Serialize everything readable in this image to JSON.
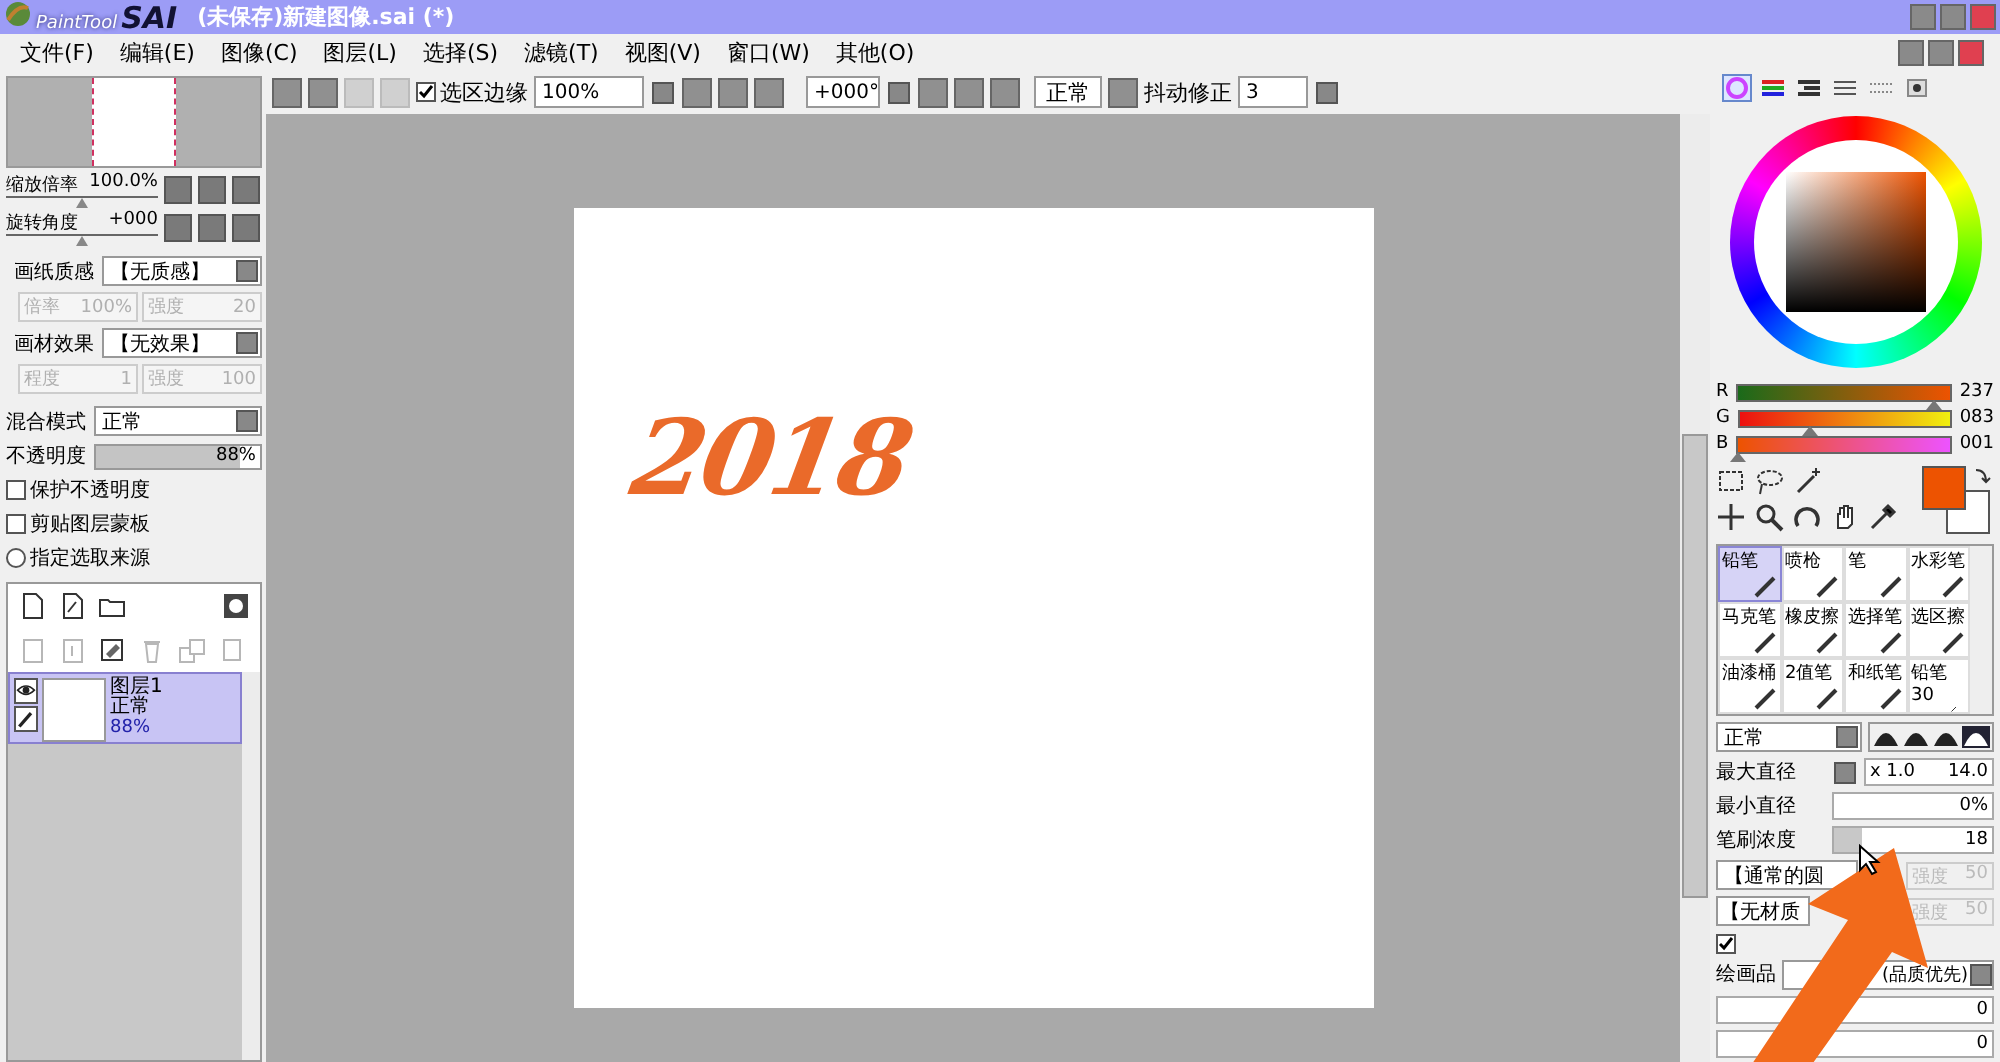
{
  "title_bar": {
    "logo_small": "PaintTool",
    "logo_big": "SAI",
    "document": "(未保存)新建图像.sai (*)"
  },
  "menu": [
    "文件(F)",
    "编辑(E)",
    "图像(C)",
    "图层(L)",
    "选择(S)",
    "滤镜(T)",
    "视图(V)",
    "窗口(W)",
    "其他(O)"
  ],
  "toolbar": {
    "selection_edge": {
      "label": "选区边缘",
      "checked": true
    },
    "zoom": "100%",
    "rotation": "+000°",
    "blend": "正常",
    "stabilizer_label": "抖动修正",
    "stabilizer_value": "3"
  },
  "navigator": {
    "sliders": [
      {
        "label": "缩放倍率",
        "value": "100.0%",
        "level": 0.5
      },
      {
        "label": "旋转角度",
        "value": "+000",
        "level": 0.5
      }
    ]
  },
  "paper": [
    {
      "label": "画纸质感",
      "value": "【无质感】",
      "fields": [
        {
          "label": "倍率",
          "value": "100%",
          "disabled": true
        },
        {
          "label": "强度",
          "value": "20",
          "disabled": true
        }
      ]
    },
    {
      "label": "画材效果",
      "value": "【无效果】",
      "fields": [
        {
          "label": "程度",
          "value": "1",
          "disabled": true
        },
        {
          "label": "强度",
          "value": "100",
          "disabled": true
        }
      ]
    }
  ],
  "layer_props": {
    "blend_label": "混合模式",
    "blend_value": "正常",
    "opacity": {
      "label": "不透明度",
      "value": "88%",
      "level": 0.88
    }
  },
  "options": [
    {
      "kind": "checkbox",
      "label": "保护不透明度",
      "checked": false
    },
    {
      "kind": "checkbox",
      "label": "剪贴图层蒙板",
      "checked": false
    },
    {
      "kind": "radio",
      "label": "指定选取来源",
      "checked": false
    }
  ],
  "layers": [
    {
      "name": "图层1",
      "mode": "正常",
      "opacity": "88%",
      "selected": true
    }
  ],
  "canvas": {
    "artwork": "2018"
  },
  "color": {
    "sliders": [
      {
        "label": "R",
        "value": "237",
        "level": 0.93
      },
      {
        "label": "G",
        "value": "083",
        "level": 0.33
      },
      {
        "label": "B",
        "value": "001",
        "level": 0.0
      }
    ]
  },
  "brushes": [
    {
      "label": "铅笔",
      "selected": true
    },
    {
      "label": "喷枪",
      "selected": false
    },
    {
      "label": "笔",
      "selected": false
    },
    {
      "label": "水彩笔",
      "selected": false
    },
    {
      "label": "马克笔",
      "selected": false
    },
    {
      "label": "橡皮擦",
      "selected": false
    },
    {
      "label": "选择笔",
      "selected": false
    },
    {
      "label": "选区擦",
      "selected": false
    },
    {
      "label": "油漆桶",
      "selected": false
    },
    {
      "label": "2值笔",
      "selected": false
    },
    {
      "label": "和纸笔",
      "selected": false
    },
    {
      "label": "铅笔30",
      "selected": false
    }
  ],
  "brush_settings": {
    "mode": "正常",
    "shapes": [
      {
        "selected": false
      },
      {
        "selected": false
      },
      {
        "selected": false
      },
      {
        "selected": true
      }
    ],
    "max_label": "最大直径",
    "max_scale": "x 1.0",
    "max_value": "14.0",
    "min_label": "最小直径",
    "min_value": "0%",
    "density": {
      "label": "笔刷浓度",
      "value": "18",
      "level": 0.18
    },
    "shape_value": "【通常的圆",
    "shape_strength": "强度",
    "shape_strength_value": "50",
    "texture_value": "【无材质",
    "texture_strength": "强度",
    "texture_strength_value": "50",
    "detail_checked": true,
    "quality_label": "绘画品",
    "quality_value": "(品质优先)",
    "rows": [
      "0",
      "0"
    ]
  }
}
